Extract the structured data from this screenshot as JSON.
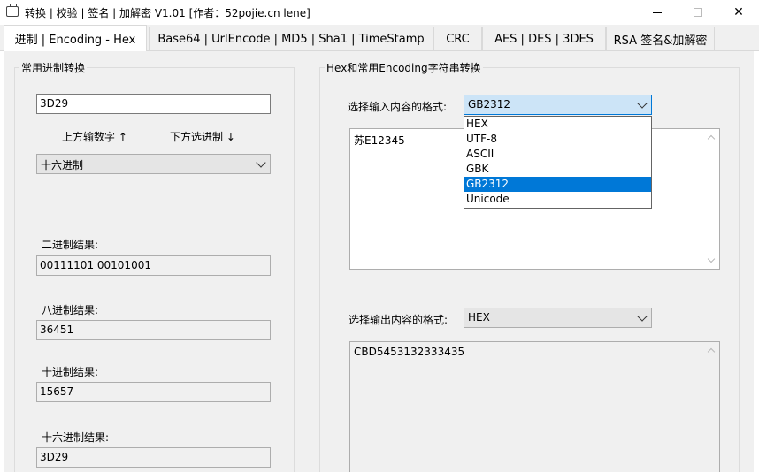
{
  "window": {
    "title": "转换 | 校验 | 签名 | 加解密 V1.01     [作者：52pojie.cn lene]",
    "icon": "briefcase-icon",
    "minimize": "—",
    "maximize": "☐",
    "close": "✕"
  },
  "tabs": [
    {
      "label": "进制  |  Encoding - Hex",
      "active": true
    },
    {
      "label": "Base64  |  UrlEncode  |  MD5  |  Sha1  |  TimeStamp"
    },
    {
      "label": "CRC"
    },
    {
      "label": "AES  |  DES  |  3DES"
    },
    {
      "label": "RSA 签名&加解密"
    }
  ],
  "left": {
    "group_title": "常用进制转换",
    "input_value": "3D29",
    "hint_left": "上方输数字 ↑",
    "hint_right": "下方选进制 ↓",
    "base_select": "十六进制",
    "binary_label": "二进制结果:",
    "binary_value": "00111101 00101001",
    "octal_label": "八进制结果:",
    "octal_value": "36451",
    "decimal_label": "十进制结果:",
    "decimal_value": "15657",
    "hex_label": "十六进制结果:",
    "hex_value": "3D29"
  },
  "right": {
    "group_title": "Hex和常用Encoding字符串转换",
    "input_format_label": "选择输入内容的格式:",
    "input_format_value": "GB2312",
    "input_text": "苏E12345",
    "dropdown_options": [
      "HEX",
      "UTF-8",
      "ASCII",
      "GBK",
      "GB2312",
      "Unicode"
    ],
    "dropdown_selected": "GB2312",
    "output_format_label": "选择输出内容的格式:",
    "output_format_value": "HEX",
    "output_text": "CBD5453132333435"
  }
}
